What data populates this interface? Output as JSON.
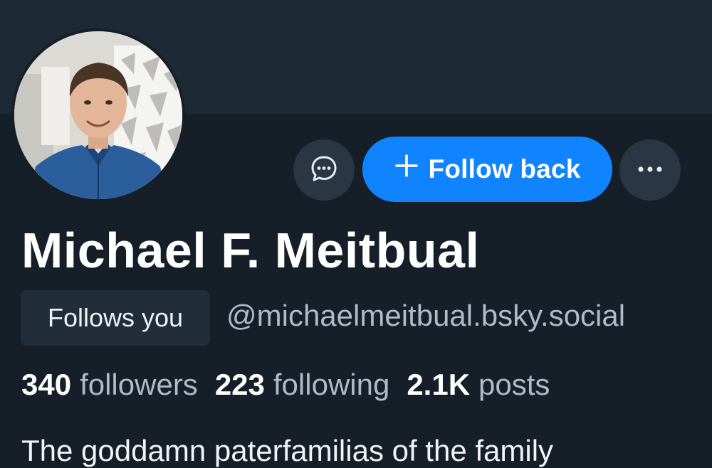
{
  "profile": {
    "display_name": "Michael F. Meitbual",
    "handle": "@michaelmeitbual.bsky.social",
    "follows_you_label": "Follows you",
    "bio": "The goddamn paterfamilias of the family"
  },
  "stats": {
    "followers_count": "340",
    "followers_label": "followers",
    "following_count": "223",
    "following_label": "following",
    "posts_count": "2.1K",
    "posts_label": "posts"
  },
  "actions": {
    "follow_back_label": "Follow back",
    "message_icon": "chat-bubble-icon",
    "more_icon": "ellipsis-icon",
    "plus_icon": "plus-icon"
  },
  "colors": {
    "background": "#161e27",
    "banner": "#1e2936",
    "accent": "#1083fe",
    "muted_text": "#aebbc9"
  }
}
